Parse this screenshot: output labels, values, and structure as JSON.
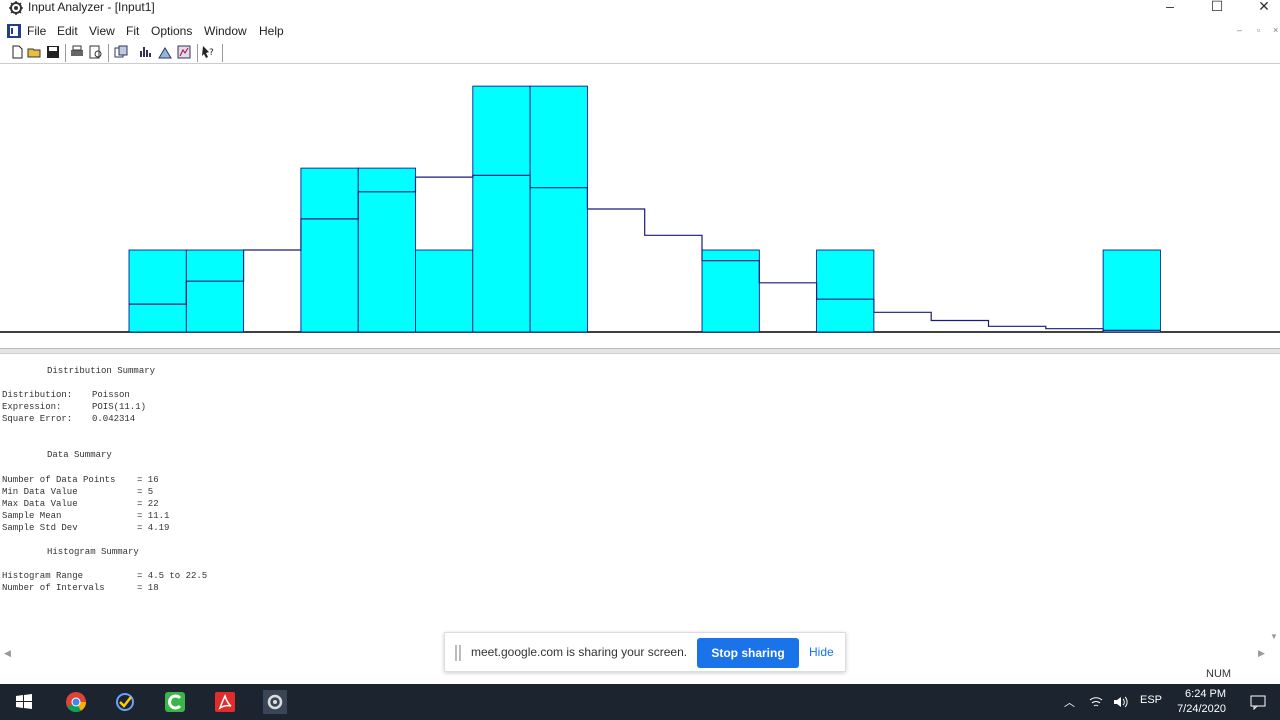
{
  "window": {
    "title": "Input Analyzer - [Input1]",
    "minimize": "–",
    "maximize": "☐",
    "close": "✕"
  },
  "menu": {
    "items": [
      "File",
      "Edit",
      "View",
      "Fit",
      "Options",
      "Window",
      "Help"
    ],
    "mdi_min": "–",
    "mdi_restore": "▫",
    "mdi_close": "×"
  },
  "chart_data": {
    "type": "bar",
    "title": "",
    "xlabel": "",
    "ylabel": "",
    "histogram_range": [
      4.5,
      22.5
    ],
    "num_intervals": 18,
    "bin_width": 1,
    "x": [
      5,
      6,
      7,
      8,
      9,
      10,
      11,
      12,
      13,
      14,
      15,
      16,
      17,
      18,
      19,
      20,
      21,
      22
    ],
    "values": [
      1,
      1,
      0,
      2,
      2,
      1,
      3,
      3,
      0,
      0,
      1,
      0,
      1,
      0,
      0,
      0,
      0,
      1
    ],
    "ylim": [
      0,
      3.05
    ],
    "fit": {
      "name": "POIS(11.1)",
      "values": [
        0.34,
        0.62,
        1.0,
        1.38,
        1.71,
        1.89,
        1.91,
        1.76,
        1.5,
        1.18,
        0.87,
        0.6,
        0.4,
        0.24,
        0.14,
        0.07,
        0.04,
        0.02
      ]
    },
    "colors": {
      "bar": "#00ffff",
      "bar_edge": "#000080",
      "fit_line": "#1a1a7a"
    }
  },
  "summary": {
    "dist_heading": "Distribution Summary",
    "distribution_label": "Distribution:",
    "distribution_value": "Poisson",
    "expression_label": "Expression:",
    "expression_value": "POIS(11.1)",
    "square_error_label": "Square Error:",
    "square_error_value": "0.042314",
    "data_heading": "Data Summary",
    "data_rows": [
      {
        "label": "Number of Data Points",
        "value": "= 16"
      },
      {
        "label": "Min Data Value",
        "value": "= 5"
      },
      {
        "label": "Max Data Value",
        "value": "= 22"
      },
      {
        "label": "Sample Mean",
        "value": "= 11.1"
      },
      {
        "label": "Sample Std Dev",
        "value": "= 4.19"
      }
    ],
    "hist_heading": "Histogram Summary",
    "hist_rows": [
      {
        "label": "Histogram Range",
        "value": "= 4.5 to 22.5"
      },
      {
        "label": "Number of Intervals",
        "value": "= 18"
      }
    ]
  },
  "share": {
    "message": "meet.google.com is sharing your screen.",
    "stop_label": "Stop sharing",
    "hide_label": "Hide",
    "button_color": "#1a73e8"
  },
  "status": {
    "num": "NUM"
  },
  "taskbar": {
    "language": "ESP",
    "time": "6:24 PM",
    "date": "7/24/2020",
    "apps": [
      "windows-start-icon",
      "chrome-icon",
      "tasks-icon",
      "camtasia-icon",
      "acrobat-icon",
      "input-analyzer-icon"
    ]
  }
}
